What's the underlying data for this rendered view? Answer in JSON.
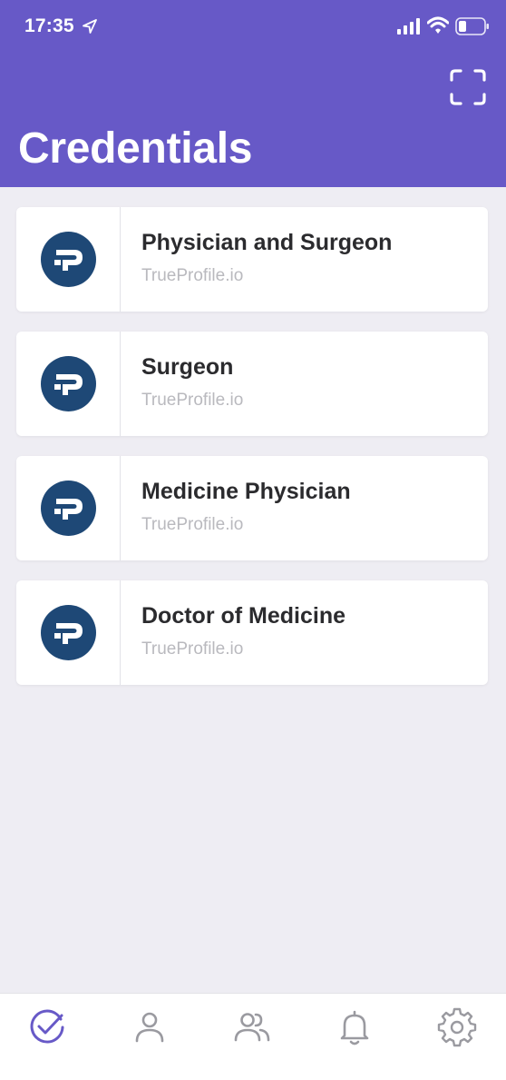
{
  "status_bar": {
    "time": "17:35"
  },
  "header": {
    "title": "Credentials",
    "scan_icon": "scan-frame-icon",
    "background_color": "#6759C7"
  },
  "credentials": [
    {
      "title": "Physician and Surgeon",
      "issuer": "TrueProfile.io",
      "logo": "trueprofile-logo"
    },
    {
      "title": "Surgeon",
      "issuer": "TrueProfile.io",
      "logo": "trueprofile-logo"
    },
    {
      "title": "Medicine Physician",
      "issuer": "TrueProfile.io",
      "logo": "trueprofile-logo"
    },
    {
      "title": "Doctor of Medicine",
      "issuer": "TrueProfile.io",
      "logo": "trueprofile-logo"
    }
  ],
  "tab_bar": {
    "active_tab": "credentials",
    "active_color": "#6759C7",
    "inactive_color": "#9A9AA0",
    "tabs": [
      {
        "id": "credentials",
        "icon": "check-circle-icon"
      },
      {
        "id": "profile",
        "icon": "person-icon"
      },
      {
        "id": "connections",
        "icon": "people-icon"
      },
      {
        "id": "notifications",
        "icon": "bell-icon"
      },
      {
        "id": "settings",
        "icon": "gear-icon"
      }
    ]
  }
}
